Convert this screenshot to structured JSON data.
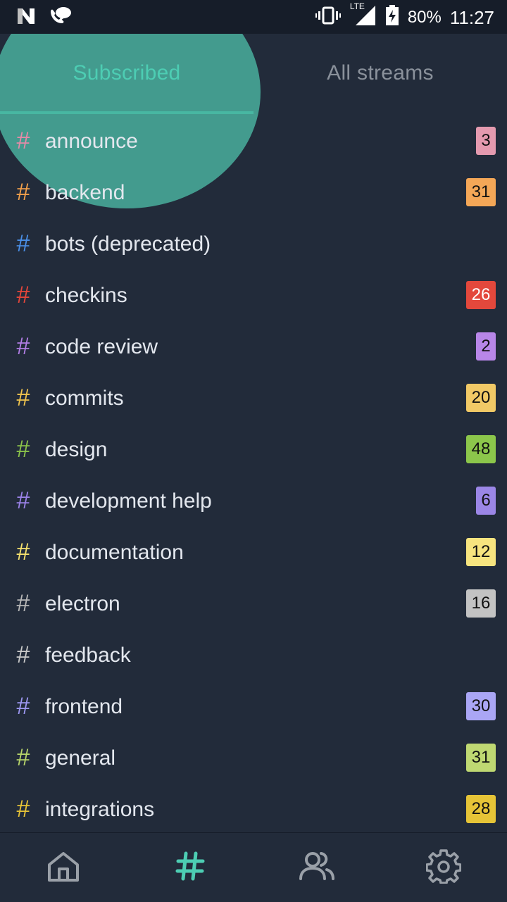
{
  "status_bar": {
    "battery": "80%",
    "time": "11:27",
    "network": "LTE",
    "left_icons": [
      "n-notification-icon",
      "chat-notification-icon"
    ],
    "right_icons": [
      "vibrate-icon",
      "signal-icon",
      "battery-charging-icon"
    ]
  },
  "tabs": {
    "subscribed": "Subscribed",
    "all_streams": "All streams",
    "active": "subscribed",
    "accent_color": "#4dcdb3"
  },
  "streams": [
    {
      "name": "announce",
      "color": "#e38ba8",
      "count": "3",
      "badge_color": "#e49aaf"
    },
    {
      "name": "backend",
      "color": "#f2a04b",
      "count": "31",
      "badge_color": "#f4a757"
    },
    {
      "name": "bots (deprecated)",
      "color": "#4a8fe7",
      "count": "",
      "badge_color": ""
    },
    {
      "name": "checkins",
      "color": "#e5463a",
      "count": "26",
      "badge_color": "#e3483c"
    },
    {
      "name": "code review",
      "color": "#b27ee6",
      "count": "2",
      "badge_color": "#b886e8"
    },
    {
      "name": "commits",
      "color": "#f0c44e",
      "count": "20",
      "badge_color": "#f1c966"
    },
    {
      "name": "design",
      "color": "#8bc34a",
      "count": "48",
      "badge_color": "#8cc64b"
    },
    {
      "name": "development help",
      "color": "#9a82e8",
      "count": "6",
      "badge_color": "#9b86e6"
    },
    {
      "name": "documentation",
      "color": "#f5e16e",
      "count": "12",
      "badge_color": "#f7e47f"
    },
    {
      "name": "electron",
      "color": "#b8b8b8",
      "count": "16",
      "badge_color": "#c3c3c3"
    },
    {
      "name": "feedback",
      "color": "#c9c9c9",
      "count": "",
      "badge_color": ""
    },
    {
      "name": "frontend",
      "color": "#9d98f2",
      "count": "30",
      "badge_color": "#aaa6f5"
    },
    {
      "name": "general",
      "color": "#b7d46a",
      "count": "31",
      "badge_color": "#bfd872"
    },
    {
      "name": "integrations",
      "color": "#e6c337",
      "count": "28",
      "badge_color": "#e6c437"
    }
  ],
  "bottom_nav": [
    {
      "name": "home",
      "icon": "home-icon",
      "active": false
    },
    {
      "name": "streams",
      "icon": "hash-icon",
      "active": true
    },
    {
      "name": "people",
      "icon": "people-icon",
      "active": false
    },
    {
      "name": "settings",
      "icon": "gear-icon",
      "active": false
    }
  ]
}
